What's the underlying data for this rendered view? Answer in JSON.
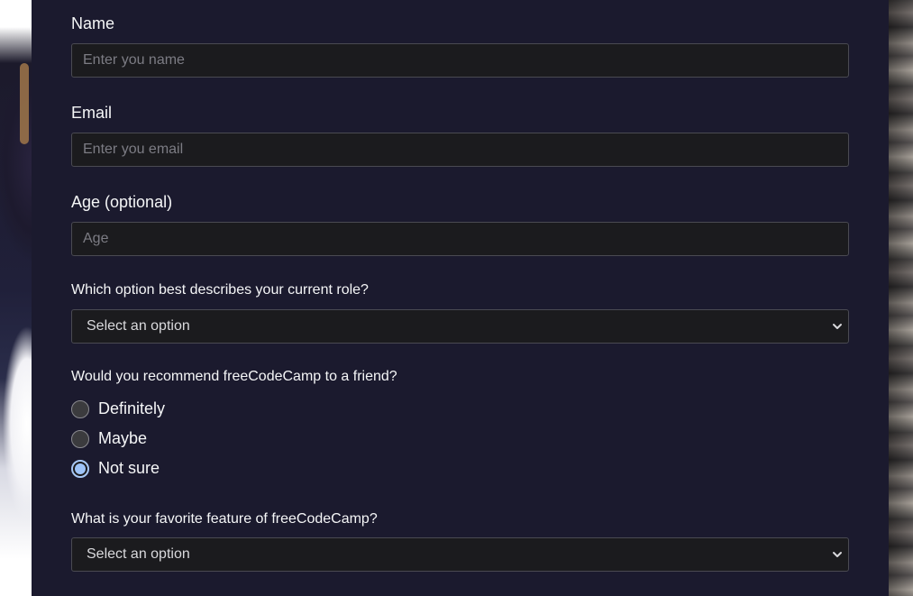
{
  "form": {
    "name": {
      "label": "Name",
      "placeholder": "Enter you name",
      "value": ""
    },
    "email": {
      "label": "Email",
      "placeholder": "Enter you email",
      "value": ""
    },
    "age": {
      "label": "Age (optional)",
      "placeholder": "Age",
      "value": ""
    },
    "role": {
      "question": "Which option best describes your current role?",
      "selected": "Select an option"
    },
    "recommend": {
      "question": "Would you recommend freeCodeCamp to a friend?",
      "options": [
        {
          "label": "Definitely",
          "checked": false
        },
        {
          "label": "Maybe",
          "checked": false
        },
        {
          "label": "Not sure",
          "checked": true
        }
      ]
    },
    "favorite": {
      "question": "What is your favorite feature of freeCodeCamp?",
      "selected": "Select an option"
    }
  },
  "icons": {
    "select_arrow": "chevron-down-icon",
    "radio_checked": "radio-checked-icon"
  },
  "colors": {
    "panel_bg": "#1b1a2e",
    "input_bg": "#1b1b1e",
    "text": "#f5f6f7",
    "radio_accent": "#9ec3f7"
  }
}
